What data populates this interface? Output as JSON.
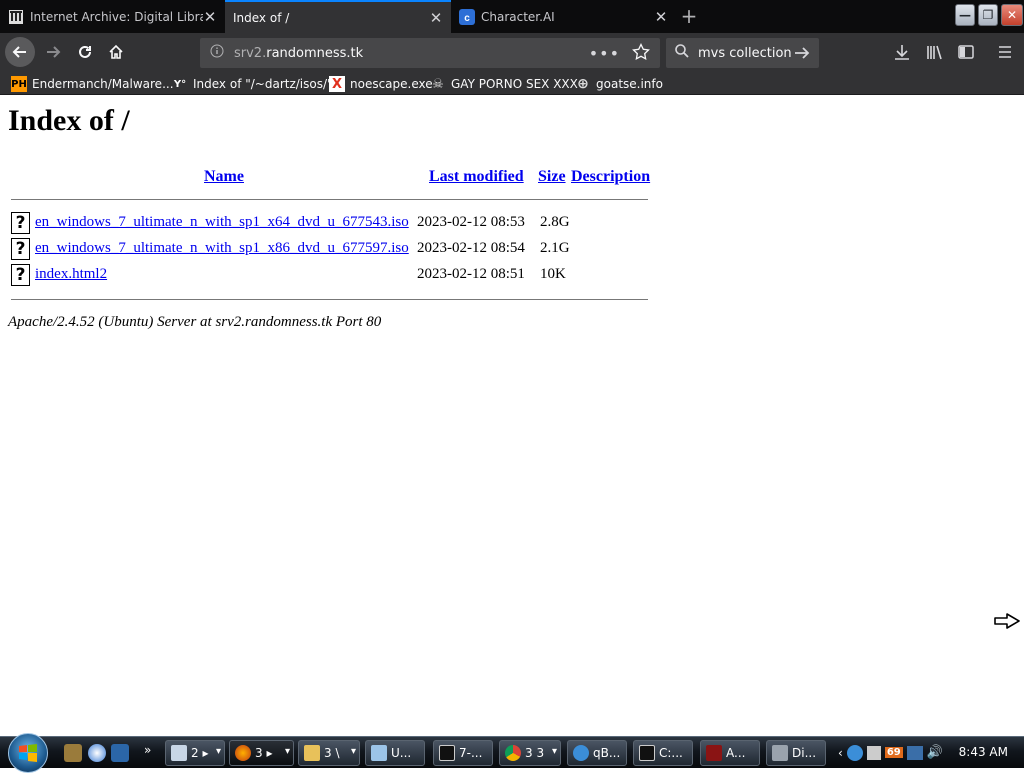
{
  "tabs": [
    {
      "title": "Internet Archive: Digital Library of Free & Borrowable Books",
      "active": false
    },
    {
      "title": "Index of /",
      "active": true
    },
    {
      "title": "Character.AI",
      "active": false
    }
  ],
  "nav": {
    "url_host_prefix": "srv2.",
    "url_host": "randomness.tk",
    "page_actions": "•••",
    "search_value": "mvs collection"
  },
  "bookmarks": [
    {
      "label": "Endermanch/Malware...",
      "icon_text": "PH",
      "icon_color": "#ff9900"
    },
    {
      "label": "Index of \"/~dartz/isos/\"",
      "icon_text": "Y°"
    },
    {
      "label": "noescape.exe",
      "icon_text": "X",
      "icon_color": "#e0301e"
    },
    {
      "label": "GAY PORNO SEX XXX",
      "icon_text": "☠"
    },
    {
      "label": "goatse.info",
      "icon_text": "⊕"
    }
  ],
  "page": {
    "heading": "Index of /",
    "columns": {
      "name": "Name",
      "modified": "Last modified",
      "size": "Size",
      "description": "Description"
    },
    "files": [
      {
        "name": "en_windows_7_ultimate_n_with_sp1_x64_dvd_u_677543.iso",
        "modified": "2023-02-12 08:53",
        "size": "2.8G",
        "icon": "?"
      },
      {
        "name": "en_windows_7_ultimate_n_with_sp1_x86_dvd_u_677597.iso",
        "modified": "2023-02-12 08:54",
        "size": "2.1G",
        "icon": "?"
      },
      {
        "name": "index.html2",
        "modified": "2023-02-12 08:51",
        "size": "10K",
        "icon": "?"
      }
    ],
    "footer": "Apache/2.4.52 (Ubuntu) Server at srv2.randomness.tk Port 80"
  },
  "taskbar": {
    "buttons": [
      {
        "label": "2 ▸"
      },
      {
        "label": "3 ▸"
      },
      {
        "label": "3 \\"
      },
      {
        "label": "U..."
      },
      {
        "label": "7-..."
      },
      {
        "label": "3 3"
      },
      {
        "label": "qB..."
      },
      {
        "label": "C:..."
      },
      {
        "label": "A..."
      },
      {
        "label": "Di..."
      }
    ],
    "tray_badge": "69",
    "clock": "8:43 AM"
  },
  "colors": {
    "accent": "#0a84ff",
    "link": "#0000ee",
    "chrome_dark": "#323234"
  }
}
